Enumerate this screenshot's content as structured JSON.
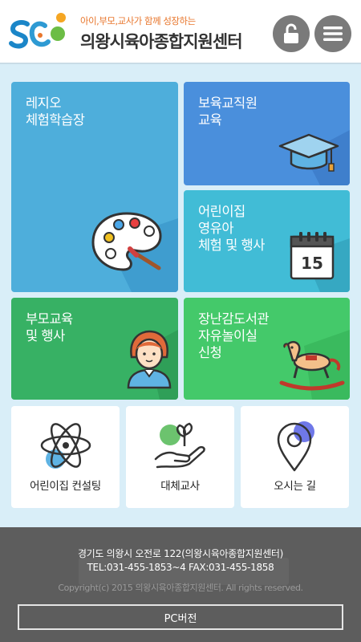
{
  "header": {
    "slogan": "아이,부모,교사가 함께 성장하는",
    "title": "의왕시육아종합지원센터",
    "lock_icon": "unlock-icon",
    "menu_icon": "hamburger-menu-icon"
  },
  "tiles": [
    {
      "label": "레지오\n체험학습장",
      "icon": "palette-icon"
    },
    {
      "label": "보육교직원\n교육",
      "icon": "graduation-cap-icon"
    },
    {
      "label": "어린이집\n영유아\n체험 및 행사",
      "icon": "calendar-icon",
      "calendar_day": "15"
    },
    {
      "label": "부모교육\n및 행사",
      "icon": "mother-icon"
    },
    {
      "label": "장난감도서관\n자유놀이실\n신청",
      "icon": "rocking-horse-icon"
    }
  ],
  "white_tiles": [
    {
      "label": "어린이집 컨설팅",
      "icon": "atom-icon"
    },
    {
      "label": "대체교사",
      "icon": "hand-sprout-icon"
    },
    {
      "label": "오시는 길",
      "icon": "map-pin-icon"
    }
  ],
  "footer": {
    "address": "경기도 의왕시 오전로 122(의왕시육아종합지원센터)",
    "tel": "TEL:031-455-1853~4   FAX:031-455-1858",
    "copyright": "Copyright(c) 2015 의왕시육아종합지원센터. All rights reserved.",
    "pc_button": "PC버전"
  },
  "colors": {
    "background": "#d9eef8",
    "tile_blue": "#4eaedb",
    "tile_royal": "#4a8fdc",
    "tile_cyan": "#41bcd6",
    "tile_green": "#37b164",
    "tile_light_green": "#44c96a",
    "footer": "#5d5d5d"
  }
}
